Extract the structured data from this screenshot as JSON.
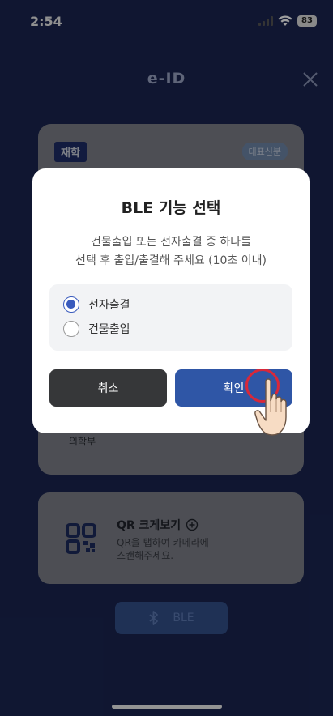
{
  "status_bar": {
    "time": "2:54",
    "battery": "83"
  },
  "header": {
    "title": "e-ID"
  },
  "card": {
    "status_tag": "재학",
    "rep_tag": "대표신분",
    "department": "의학부"
  },
  "qr": {
    "title": "QR 크게보기",
    "desc_line1": "QR을 탭하여 카메라에",
    "desc_line2": "스캔해주세요."
  },
  "ble_button": {
    "label": "BLE"
  },
  "modal": {
    "title": "BLE 기능 선택",
    "desc_line1": "건물출입 또는 전자출결 중 하나를",
    "desc_line2": "선택 후 출입/출결해 주세요 (10초 이내)",
    "options": [
      {
        "label": "전자출결",
        "selected": true
      },
      {
        "label": "건물출입",
        "selected": false
      }
    ],
    "cancel_label": "취소",
    "confirm_label": "확인"
  },
  "colors": {
    "background": "#1a2550",
    "accent": "#2f56a6",
    "tap_ring": "#d8283a"
  }
}
